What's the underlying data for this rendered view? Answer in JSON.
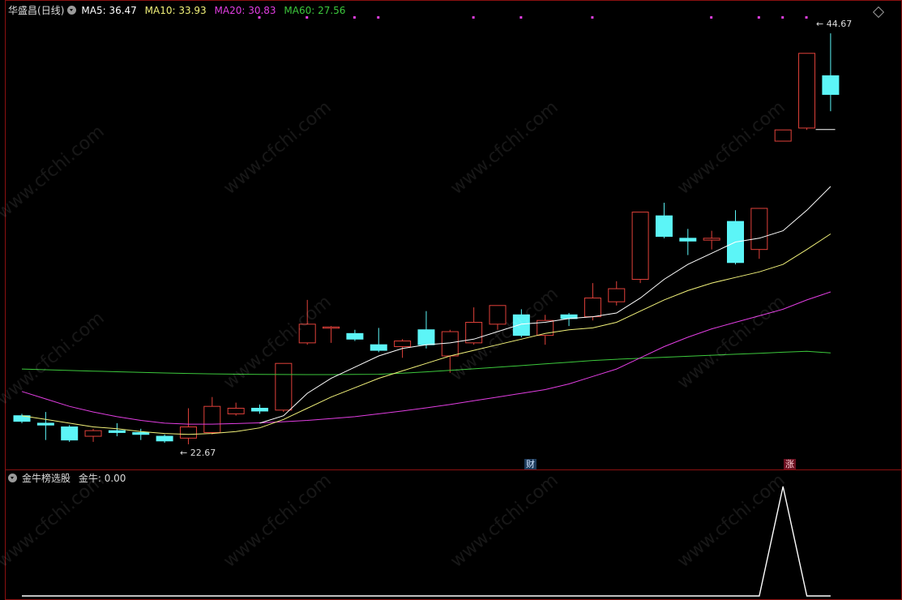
{
  "main_header": {
    "stock_name": "华盛昌",
    "period": "(日线)",
    "ma5": "MA5: 36.47",
    "ma10": "MA10: 33.93",
    "ma20": "MA20: 30.83",
    "ma60": "MA60: 27.56"
  },
  "sub_header": {
    "indicator_name": "金牛榜选股",
    "value": "金牛: 0.00"
  },
  "watermark": "www.cfchi.com",
  "badges": {
    "finance": "财",
    "limit_up": "涨"
  },
  "price_labels": {
    "high": "44.67",
    "low": "22.67"
  },
  "colors": {
    "up": "#e0413a",
    "down": "#5cf5f7",
    "ma5": "#ffffff",
    "ma10": "#f2f27a",
    "ma20": "#e23ee2",
    "ma60": "#3cc83c",
    "frame": "#8a1010"
  },
  "chart_data": [
    {
      "type": "candlestick",
      "title": "华盛昌 (日线)",
      "price_range": [
        21.8,
        45.5
      ],
      "candles": [
        {
          "o": 24.2,
          "c": 23.9,
          "h": 24.3,
          "l": 23.8
        },
        {
          "o": 23.8,
          "c": 23.7,
          "h": 24.4,
          "l": 22.9
        },
        {
          "o": 23.6,
          "c": 22.9,
          "h": 23.7,
          "l": 22.8
        },
        {
          "o": 23.1,
          "c": 23.4,
          "h": 23.5,
          "l": 22.8
        },
        {
          "o": 23.4,
          "c": 23.3,
          "h": 23.8,
          "l": 23.1
        },
        {
          "o": 23.3,
          "c": 23.2,
          "h": 23.5,
          "l": 22.9
        },
        {
          "o": 23.1,
          "c": 22.85,
          "h": 23.2,
          "l": 22.75
        },
        {
          "o": 23.0,
          "c": 23.6,
          "h": 24.6,
          "l": 22.67
        },
        {
          "o": 23.3,
          "c": 24.7,
          "h": 25.2,
          "l": 23.2
        },
        {
          "o": 24.3,
          "c": 24.6,
          "h": 24.9,
          "l": 24.2
        },
        {
          "o": 24.6,
          "c": 24.45,
          "h": 24.8,
          "l": 24.3
        },
        {
          "o": 24.5,
          "c": 27.0,
          "h": 27.0,
          "l": 24.4
        },
        {
          "o": 28.1,
          "c": 29.1,
          "h": 30.4,
          "l": 28.0
        },
        {
          "o": 28.9,
          "c": 28.95,
          "h": 29.0,
          "l": 28.1
        },
        {
          "o": 28.6,
          "c": 28.3,
          "h": 28.8,
          "l": 28.2
        },
        {
          "o": 28.0,
          "c": 27.7,
          "h": 28.9,
          "l": 27.6
        },
        {
          "o": 27.9,
          "c": 28.2,
          "h": 28.3,
          "l": 27.3
        },
        {
          "o": 28.8,
          "c": 28.0,
          "h": 29.8,
          "l": 27.8
        },
        {
          "o": 27.4,
          "c": 28.7,
          "h": 28.8,
          "l": 26.5
        },
        {
          "o": 28.1,
          "c": 29.2,
          "h": 30.0,
          "l": 28.0
        },
        {
          "o": 29.1,
          "c": 30.1,
          "h": 30.1,
          "l": 28.8
        },
        {
          "o": 29.6,
          "c": 28.5,
          "h": 29.9,
          "l": 28.4
        },
        {
          "o": 28.5,
          "c": 29.3,
          "h": 29.6,
          "l": 28.0
        },
        {
          "o": 29.6,
          "c": 29.4,
          "h": 29.7,
          "l": 29.0
        },
        {
          "o": 29.5,
          "c": 30.5,
          "h": 31.3,
          "l": 29.3
        },
        {
          "o": 30.3,
          "c": 31.0,
          "h": 31.4,
          "l": 30.1
        },
        {
          "o": 31.5,
          "c": 35.1,
          "h": 35.1,
          "l": 31.3
        },
        {
          "o": 34.9,
          "c": 33.8,
          "h": 35.6,
          "l": 33.7
        },
        {
          "o": 33.7,
          "c": 33.55,
          "h": 34.2,
          "l": 32.8
        },
        {
          "o": 33.6,
          "c": 33.7,
          "h": 34.1,
          "l": 33.1
        },
        {
          "o": 34.6,
          "c": 32.4,
          "h": 35.2,
          "l": 32.3
        },
        {
          "o": 33.1,
          "c": 35.3,
          "h": 35.3,
          "l": 32.6
        },
        {
          "o": 38.9,
          "c": 39.5,
          "h": 39.5,
          "l": 38.9
        },
        {
          "o": 39.6,
          "c": 43.6,
          "h": 43.6,
          "l": 39.5
        },
        {
          "o": 42.4,
          "c": 41.4,
          "h": 44.67,
          "l": 40.5
        }
      ],
      "ma": {
        "MA5": [
          null,
          null,
          null,
          null,
          null,
          null,
          null,
          null,
          null,
          null,
          23.8,
          24.2,
          25.4,
          26.2,
          26.8,
          27.4,
          27.8,
          28.0,
          28.1,
          28.3,
          28.7,
          29.1,
          29.2,
          29.4,
          29.5,
          29.7,
          30.5,
          31.5,
          32.3,
          32.9,
          33.5,
          33.7,
          34.1,
          35.2,
          36.47
        ],
        "MA10": [
          24.2,
          24.0,
          23.8,
          23.6,
          23.5,
          23.35,
          23.25,
          23.2,
          23.25,
          23.35,
          23.55,
          24.0,
          24.6,
          25.2,
          25.7,
          26.2,
          26.6,
          27.0,
          27.4,
          27.7,
          28.0,
          28.3,
          28.6,
          28.8,
          28.9,
          29.2,
          29.8,
          30.4,
          30.9,
          31.3,
          31.6,
          31.9,
          32.3,
          33.1,
          33.93
        ],
        "MA20": [
          25.5,
          25.1,
          24.7,
          24.4,
          24.15,
          23.95,
          23.8,
          23.75,
          23.75,
          23.78,
          23.82,
          23.88,
          23.95,
          24.05,
          24.15,
          24.3,
          24.45,
          24.62,
          24.8,
          25.0,
          25.2,
          25.4,
          25.6,
          25.9,
          26.3,
          26.7,
          27.3,
          27.9,
          28.4,
          28.85,
          29.2,
          29.55,
          29.9,
          30.4,
          30.83
        ]
      },
      "ma60": {
        "start": 26.7,
        "end": 27.56
      }
    },
    {
      "type": "line",
      "title": "金牛榜选股",
      "series": [
        {
          "name": "金牛",
          "values": [
            0,
            0,
            0,
            0,
            0,
            0,
            0,
            0,
            0,
            0,
            0,
            0,
            0,
            0,
            0,
            0,
            0,
            0,
            0,
            0,
            0,
            0,
            0,
            0,
            0,
            0,
            0,
            0,
            0,
            0,
            0,
            0,
            1,
            0,
            0
          ]
        }
      ]
    }
  ]
}
